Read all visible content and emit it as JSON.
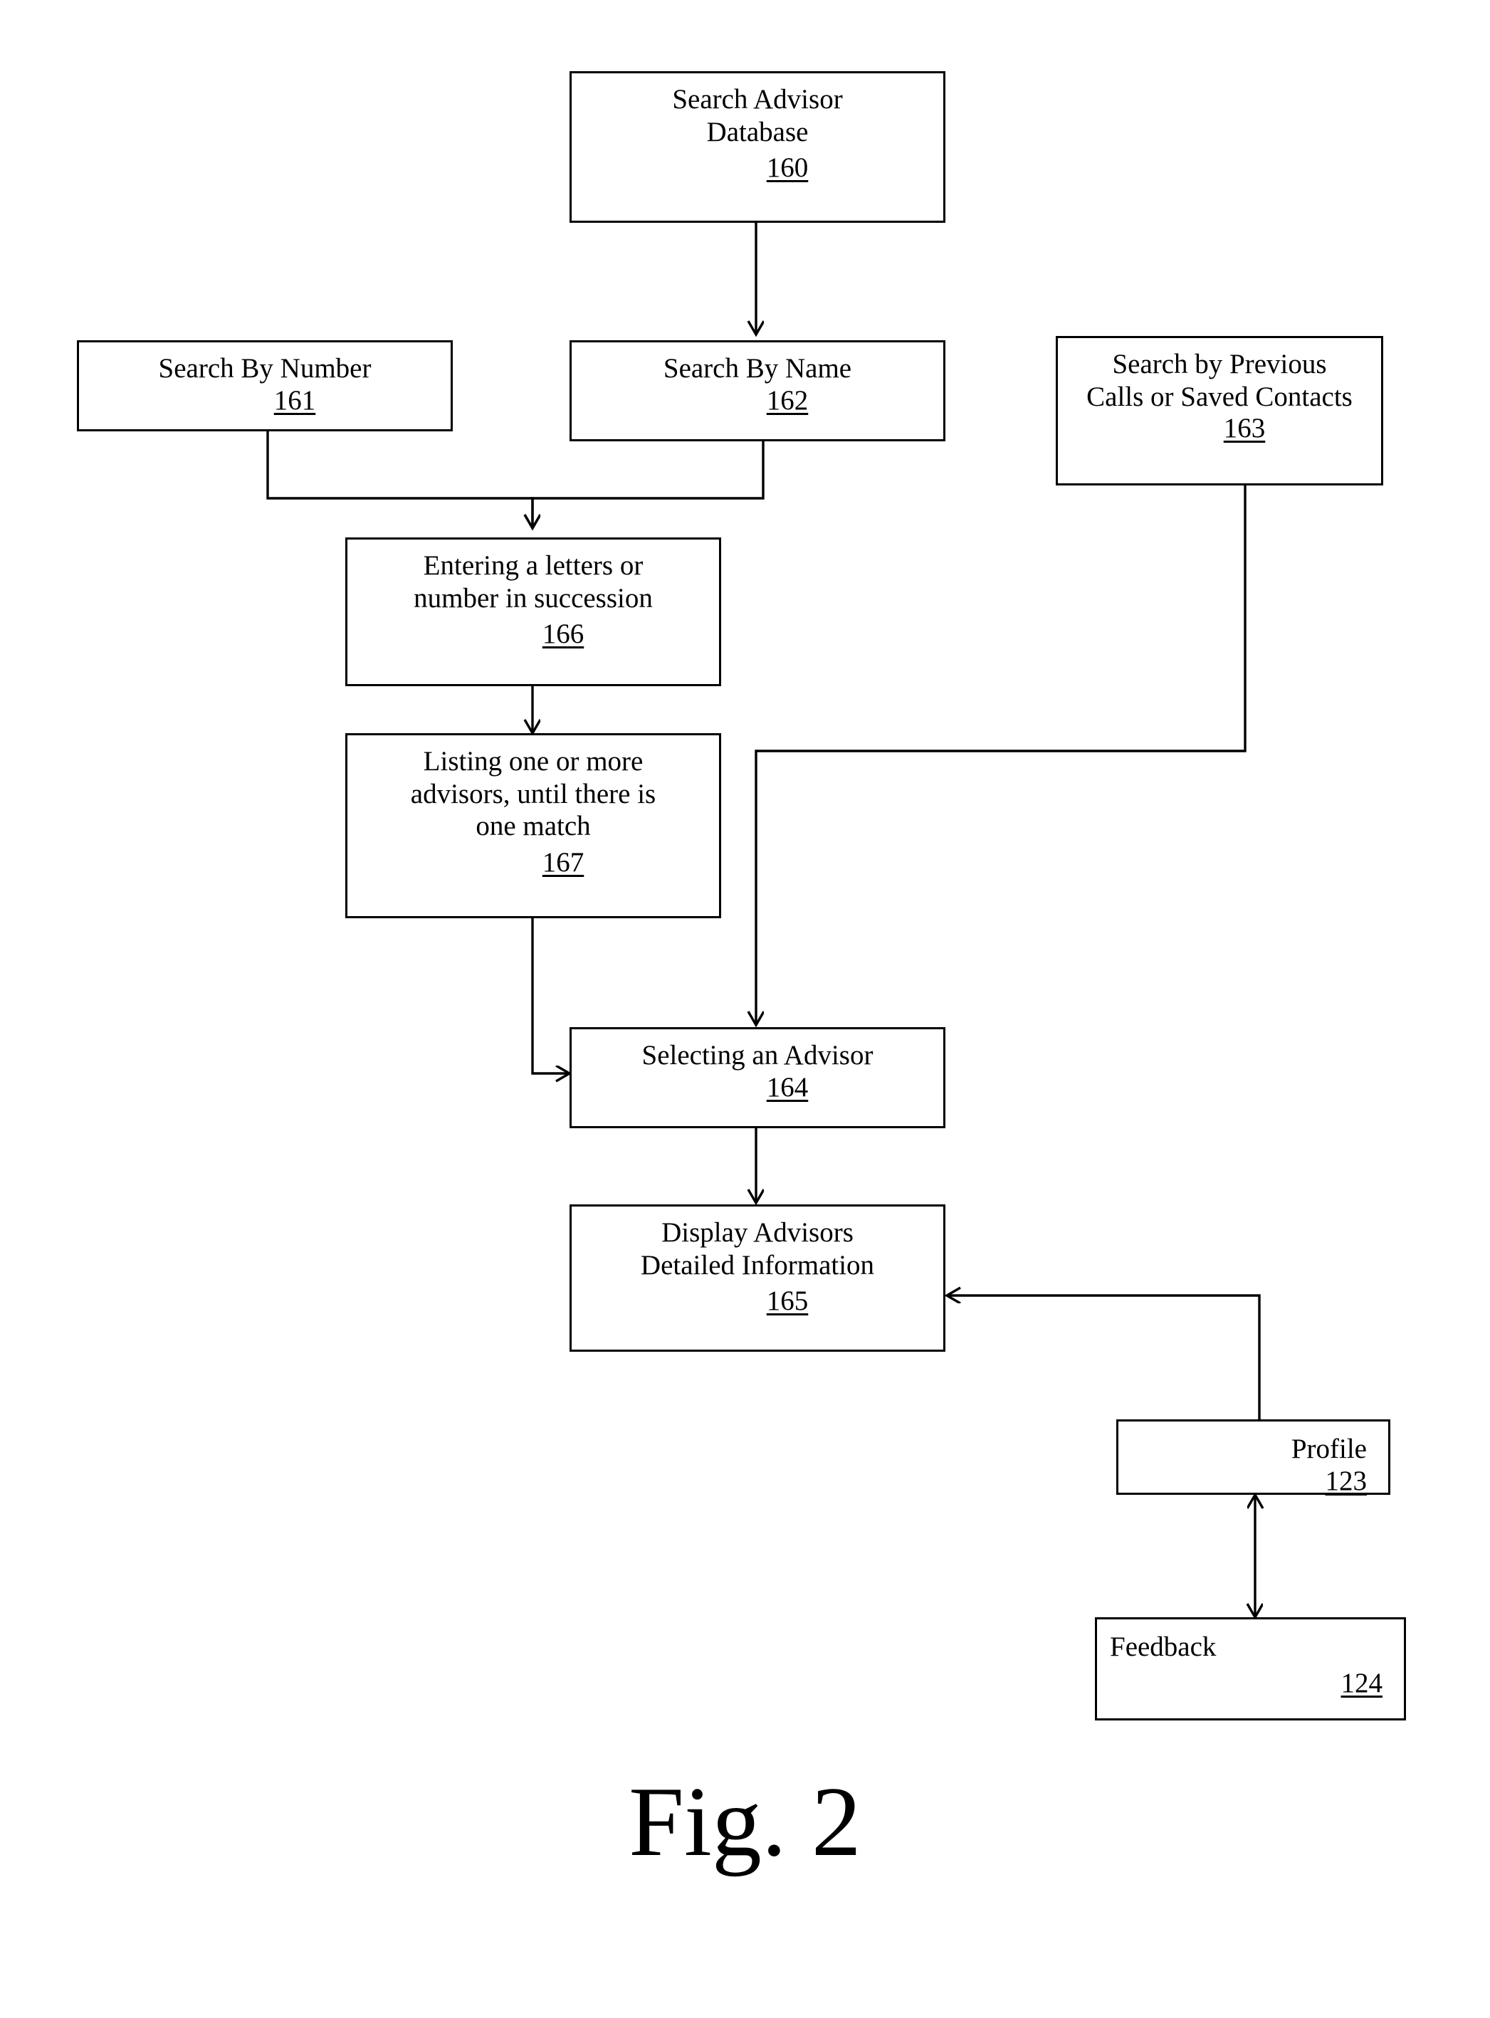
{
  "figure": {
    "caption": "Fig. 2"
  },
  "nodes": {
    "search_advisor_database": {
      "text": "Search Advisor\nDatabase",
      "ref": "160"
    },
    "search_by_number": {
      "text": "Search By Number",
      "ref": "161"
    },
    "search_by_name": {
      "text": "Search By Name",
      "ref": "162"
    },
    "search_by_previous_calls": {
      "text": "Search by Previous\nCalls or Saved Contacts",
      "ref": "163"
    },
    "entering_letters_or_number": {
      "text": "Entering a letters or\nnumber in succession",
      "ref": "166"
    },
    "listing_advisors": {
      "text": "Listing one or more\nadvisors, until there is\none match",
      "ref": "167"
    },
    "selecting_an_advisor": {
      "text": "Selecting an Advisor",
      "ref": "164"
    },
    "display_advisor_details": {
      "text": "Display Advisors\nDetailed Information",
      "ref": "165"
    },
    "profile": {
      "text": "Profile",
      "ref": "123"
    },
    "feedback": {
      "text": "Feedback",
      "ref": "124"
    }
  },
  "colors": {
    "stroke": "#000000",
    "background": "#ffffff"
  }
}
